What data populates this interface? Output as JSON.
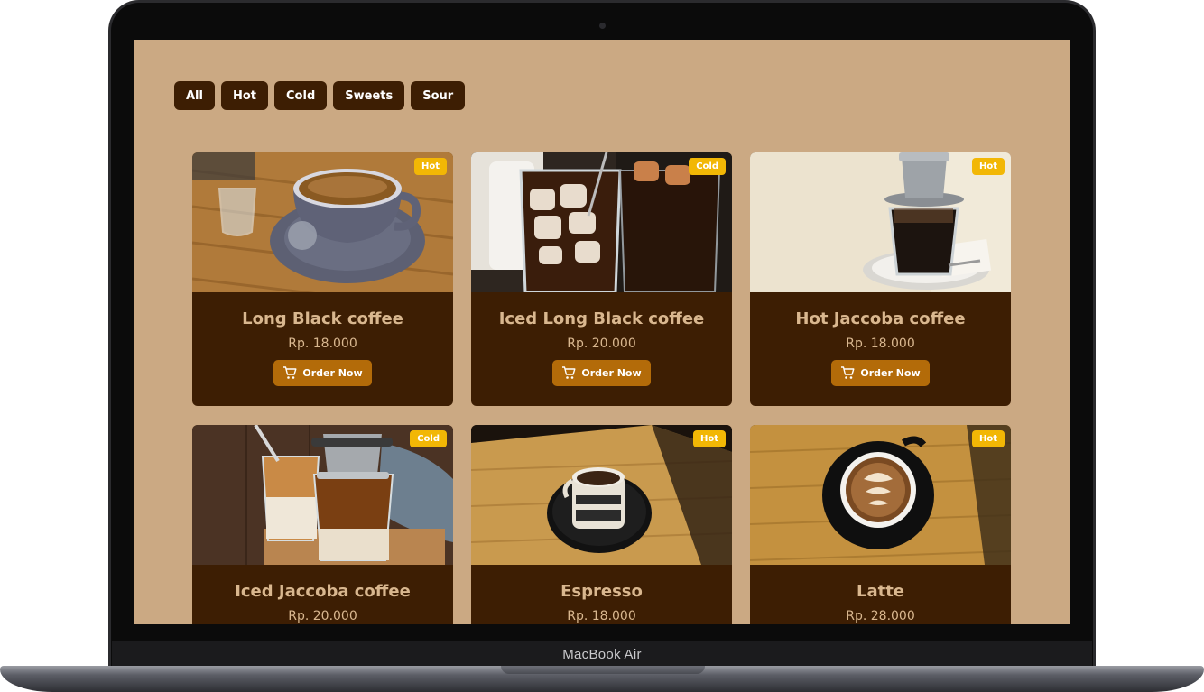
{
  "device": {
    "label": "MacBook Air"
  },
  "filters": [
    "All",
    "Hot",
    "Cold",
    "Sweets",
    "Sour"
  ],
  "order_label": "Order Now",
  "products": [
    {
      "name": "Long Black coffee",
      "price": "Rp. 18.000",
      "tag": "Hot"
    },
    {
      "name": "Iced Long Black coffee",
      "price": "Rp. 20.000",
      "tag": "Cold"
    },
    {
      "name": "Hot Jaccoba coffee",
      "price": "Rp. 18.000",
      "tag": "Hot"
    },
    {
      "name": "Iced Jaccoba coffee",
      "price": "Rp. 20.000",
      "tag": "Cold"
    },
    {
      "name": "Espresso",
      "price": "Rp. 18.000",
      "tag": "Hot"
    },
    {
      "name": "Latte",
      "price": "Rp. 28.000",
      "tag": "Hot"
    }
  ],
  "colors": {
    "page_bg": "#cba983",
    "dark_brown": "#3d1e03",
    "title_text": "#d9b78f",
    "button_orange": "#b36b09",
    "tag_yellow": "#f2b705"
  }
}
